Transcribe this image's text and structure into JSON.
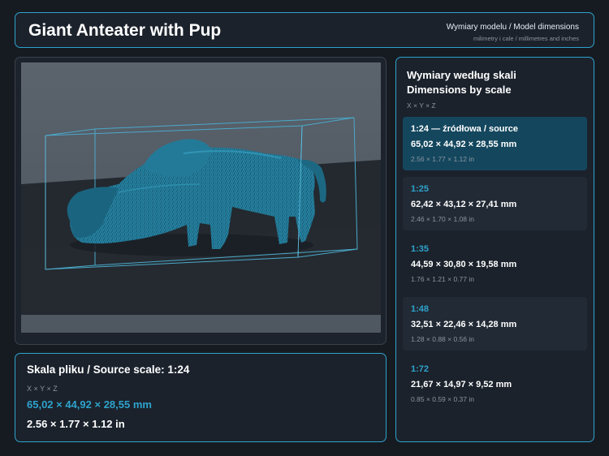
{
  "header": {
    "title": "Giant Anteater with Pup",
    "subtitle": "Wymiary modelu / Model dimensions",
    "units_note": "milimetry i cale / millimetres and inches"
  },
  "source": {
    "title": "Skala pliku / Source scale: 1:24",
    "axes": "X × Y × Z",
    "mm": "65,02 × 44,92 × 28,55 mm",
    "inches": "2.56 × 1.77 × 1.12 in"
  },
  "dimensions": {
    "title_line1": "Wymiary według skali",
    "title_line2": "Dimensions by scale",
    "axes": "X × Y × Z",
    "scales": [
      {
        "label": "1:24  —  źródłowa / source",
        "mm": "65,02 × 44,92 × 28,55 mm",
        "inches": "2.56 × 1.77 × 1.12 in",
        "active": true
      },
      {
        "label": "1:25",
        "mm": "62,42 × 43,12 × 27,41 mm",
        "inches": "2.46 × 1.70 × 1.08 in",
        "active": false
      },
      {
        "label": "1:35",
        "mm": "44,59 × 30,80 × 19,58 mm",
        "inches": "1.76 × 1.21 × 0.77 in",
        "active": false
      },
      {
        "label": "1:48",
        "mm": "32,51 × 22,46 × 14,28 mm",
        "inches": "1.28 × 0.88 × 0.56 in",
        "active": false
      },
      {
        "label": "1:72",
        "mm": "21,67 × 14,97 × 9,52 mm",
        "inches": "0.85 × 0.59 × 0.37 in",
        "active": false
      }
    ]
  },
  "colors": {
    "accent": "#2ea3cc",
    "background": "#161b22",
    "panel": "#1b222c",
    "active_card": "#14475e",
    "model": "#1f6f8b"
  }
}
